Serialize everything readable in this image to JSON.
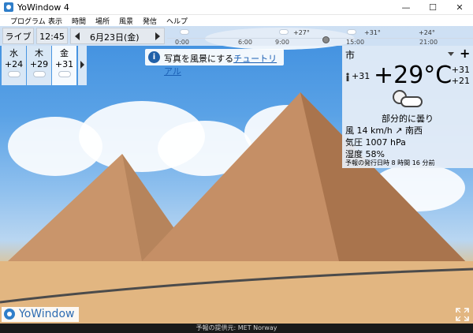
{
  "window": {
    "title": "YoWindow 4",
    "minimize": "—",
    "maximize": "☐",
    "close": "✕"
  },
  "menu": [
    "プログラム",
    "表示",
    "時間",
    "場所",
    "風景",
    "発信",
    "ヘルプ"
  ],
  "topbar": {
    "live_label": "ライブ",
    "time": "12:45",
    "date": "6月23日(金)"
  },
  "timeline": {
    "hours": [
      "0:00",
      "6:00",
      "9:00",
      "15:00",
      "21:00"
    ],
    "temps": [
      "+27°",
      "+31°",
      "+24°"
    ]
  },
  "forecast": [
    {
      "day": "水",
      "temp": "+24",
      "icon": "partly-cloudy-icon"
    },
    {
      "day": "木",
      "temp": "+29",
      "icon": "partly-cloudy-icon"
    },
    {
      "day": "金",
      "temp": "+31",
      "icon": "partly-cloudy-icon"
    }
  ],
  "tutorial": {
    "text": "写真を風景にする",
    "link": "チュートリアル"
  },
  "current": {
    "city": "市",
    "add": "+",
    "feels_like": "+31",
    "temperature": "+29°C",
    "high": "+31",
    "low": "+21",
    "condition": "部分的に曇り",
    "wind": "風  14 km/h ↗ 南西",
    "pressure": "気圧  1007 hPa",
    "humidity": "湿度  58%",
    "updated": "予報の発行日時 8 時間 16 分前"
  },
  "logo": "YoWindow",
  "status": "予報の提供元: MET Norway",
  "colors": {
    "sky": "#3f8fdf",
    "sand": "#e2b681",
    "accent": "#2f7ec9"
  }
}
